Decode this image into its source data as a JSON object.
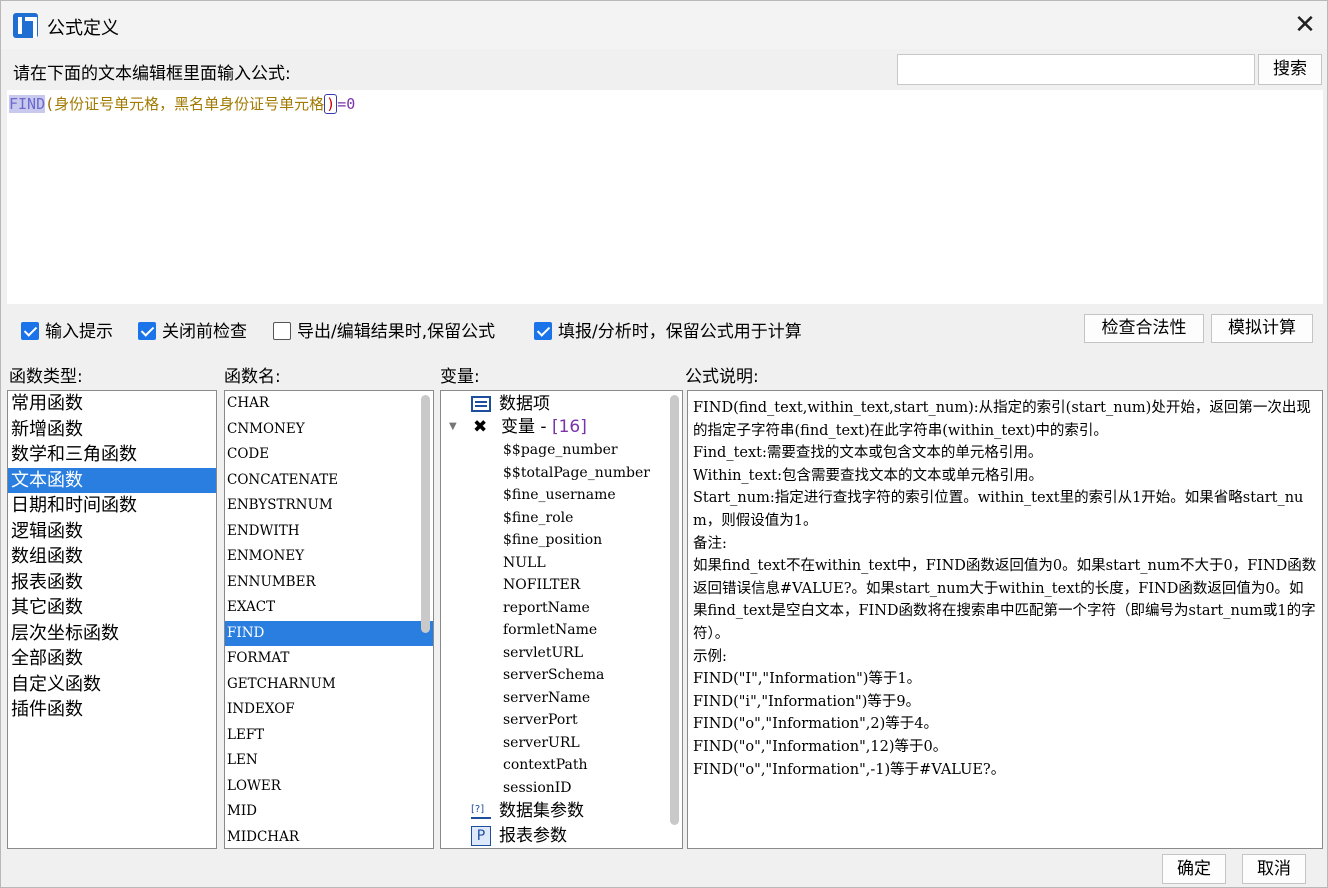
{
  "window": {
    "title": "公式定义",
    "close_glyph": "✕"
  },
  "prompt": "请在下面的文本编辑框里面输入公式:",
  "search": {
    "value": "",
    "button": "搜索"
  },
  "formula": {
    "fn": "FIND",
    "open": "(",
    "args": "身份证号单元格，黑名单身份证号单元格",
    "close": ")",
    "rest": "=0"
  },
  "options": [
    {
      "label": "输入提示",
      "checked": true
    },
    {
      "label": "关闭前检查",
      "checked": true
    },
    {
      "label": "导出/编辑结果时,保留公式",
      "checked": false
    },
    {
      "label": "填报/分析时，保留公式用于计算",
      "checked": true
    }
  ],
  "buttons": {
    "check": "检查合法性",
    "simulate": "模拟计算",
    "ok": "确定",
    "cancel": "取消"
  },
  "labels": {
    "categories": "函数类型:",
    "functions": "函数名:",
    "variables": "变量:",
    "description": "公式说明:"
  },
  "categories": [
    "常用函数",
    "新增函数",
    "数学和三角函数",
    "文本函数",
    "日期和时间函数",
    "逻辑函数",
    "数组函数",
    "报表函数",
    "其它函数",
    "层次坐标函数",
    "全部函数",
    "自定义函数",
    "插件函数"
  ],
  "selected_category": "文本函数",
  "functions": [
    "CHAR",
    "CNMONEY",
    "CODE",
    "CONCATENATE",
    "ENBYSTRNUM",
    "ENDWITH",
    "ENMONEY",
    "ENNUMBER",
    "EXACT",
    "FIND",
    "FORMAT",
    "GETCHARNUM",
    "INDEXOF",
    "LEFT",
    "LEN",
    "LOWER",
    "MID",
    "MIDCHAR"
  ],
  "selected_function": "FIND",
  "variables": {
    "data_items": "数据项",
    "vars": "变量",
    "vars_count": "[16]",
    "leaves": [
      "$$page_number",
      "$$totalPage_number",
      "$fine_username",
      "$fine_role",
      "$fine_position",
      "NULL",
      "NOFILTER",
      "reportName",
      "formletName",
      "servletURL",
      "serverSchema",
      "serverName",
      "serverPort",
      "serverURL",
      "contextPath",
      "sessionID"
    ],
    "dataset_params": "数据集参数",
    "report_params": "报表参数"
  },
  "description": [
    "FIND(find_text,within_text,start_num):从指定的索引(start_num)处开始，返回第一次出现的指定子字符串(find_text)在此字符串(within_text)中的索引。",
    "Find_text:需要查找的文本或包含文本的单元格引用。",
    "Within_text:包含需要查找文本的文本或单元格引用。",
    "Start_num:指定进行查找字符的索引位置。within_text里的索引从1开始。如果省略start_num，则假设值为1。",
    "备注:",
    "如果find_text不在within_text中，FIND函数返回值为0。如果start_num不大于0，FIND函数返回错误信息#VALUE?。如果start_num大于within_text的长度，FIND函数返回值为0。如果find_text是空白文本，FIND函数将在搜索串中匹配第一个字符（即编号为start_num或1的字符）。",
    "示例:",
    "FIND(\"I\",\"Information\")等于1。",
    "FIND(\"i\",\"Information\")等于9。",
    "FIND(\"o\",\"Information\",2)等于4。",
    "FIND(\"o\",\"Information\",12)等于0。",
    "FIND(\"o\",\"Information\",-1)等于#VALUE?。"
  ]
}
